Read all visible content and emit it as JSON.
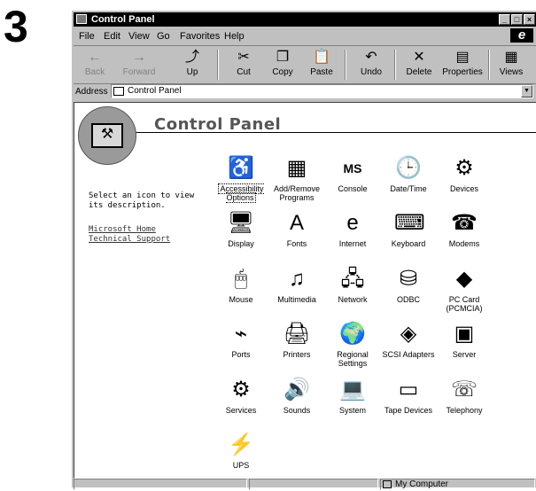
{
  "step_number": "3",
  "window": {
    "title": "Control Panel",
    "controls": [
      "_",
      "□",
      "×"
    ]
  },
  "menu": [
    "File",
    "Edit",
    "View",
    "Go",
    "Favorites",
    "Help"
  ],
  "toolbar": {
    "back": "Back",
    "forward": "Forward",
    "up": "Up",
    "cut": "Cut",
    "copy": "Copy",
    "paste": "Paste",
    "undo": "Undo",
    "delete": "Delete",
    "properties": "Properties",
    "views": "Views"
  },
  "address": {
    "label": "Address",
    "value": "Control Panel"
  },
  "content": {
    "title": "Control Panel",
    "description": "Select an icon to view its description.",
    "links": [
      "Microsoft Home",
      "Technical Support"
    ]
  },
  "icons": [
    {
      "label": "Accessibility Options",
      "icon": "accessibility-icon",
      "glyph": "♿"
    },
    {
      "label": "Add/Remove Programs",
      "icon": "add-remove-programs-icon",
      "glyph": "▦"
    },
    {
      "label": "Console",
      "icon": "console-icon",
      "glyph": "MS"
    },
    {
      "label": "Date/Time",
      "icon": "date-time-icon",
      "glyph": "🕒"
    },
    {
      "label": "Devices",
      "icon": "devices-icon",
      "glyph": "⚙"
    },
    {
      "label": "Display",
      "icon": "display-icon",
      "glyph": "🖥"
    },
    {
      "label": "Fonts",
      "icon": "fonts-icon",
      "glyph": "A"
    },
    {
      "label": "Internet",
      "icon": "internet-icon",
      "glyph": "e"
    },
    {
      "label": "Keyboard",
      "icon": "keyboard-icon",
      "glyph": "⌨"
    },
    {
      "label": "Modems",
      "icon": "modems-icon",
      "glyph": "☎"
    },
    {
      "label": "Mouse",
      "icon": "mouse-icon",
      "glyph": "🖱"
    },
    {
      "label": "Multimedia",
      "icon": "multimedia-icon",
      "glyph": "♫"
    },
    {
      "label": "Network",
      "icon": "network-icon",
      "glyph": "🖧"
    },
    {
      "label": "ODBC",
      "icon": "odbc-icon",
      "glyph": "⛁"
    },
    {
      "label": "PC Card (PCMCIA)",
      "icon": "pc-card-icon",
      "glyph": "◆"
    },
    {
      "label": "Ports",
      "icon": "ports-icon",
      "glyph": "⌁"
    },
    {
      "label": "Printers",
      "icon": "printers-icon",
      "glyph": "🖨"
    },
    {
      "label": "Regional Settings",
      "icon": "regional-settings-icon",
      "glyph": "🌍"
    },
    {
      "label": "SCSI Adapters",
      "icon": "scsi-adapters-icon",
      "glyph": "◈"
    },
    {
      "label": "Server",
      "icon": "server-icon",
      "glyph": "▣"
    },
    {
      "label": "Services",
      "icon": "services-icon",
      "glyph": "⚙"
    },
    {
      "label": "Sounds",
      "icon": "sounds-icon",
      "glyph": "🔊"
    },
    {
      "label": "System",
      "icon": "system-icon",
      "glyph": "💻"
    },
    {
      "label": "Tape Devices",
      "icon": "tape-devices-icon",
      "glyph": "▭"
    },
    {
      "label": "Telephony",
      "icon": "telephony-icon",
      "glyph": "☏"
    },
    {
      "label": "UPS",
      "icon": "ups-icon",
      "glyph": "⚡"
    }
  ],
  "status": {
    "zone": "My Computer"
  }
}
